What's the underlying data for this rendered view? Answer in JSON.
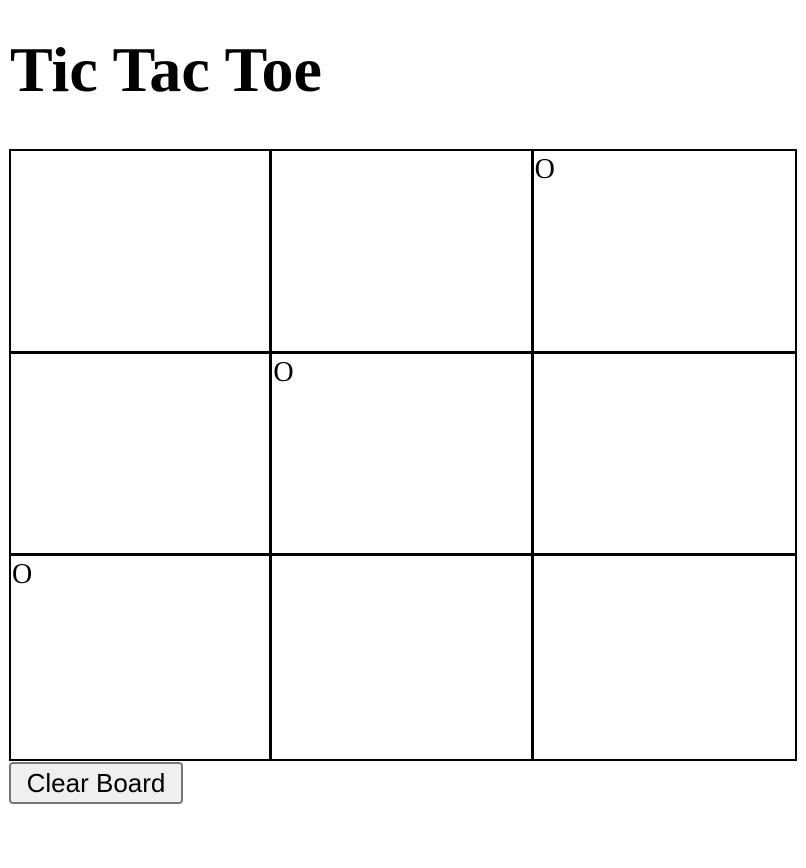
{
  "page": {
    "title": "Tic Tac Toe"
  },
  "board": {
    "cells": [
      [
        "",
        "",
        "O"
      ],
      [
        "",
        "O",
        ""
      ],
      [
        "O",
        "",
        ""
      ]
    ]
  },
  "controls": {
    "clear_label": "Clear Board"
  }
}
